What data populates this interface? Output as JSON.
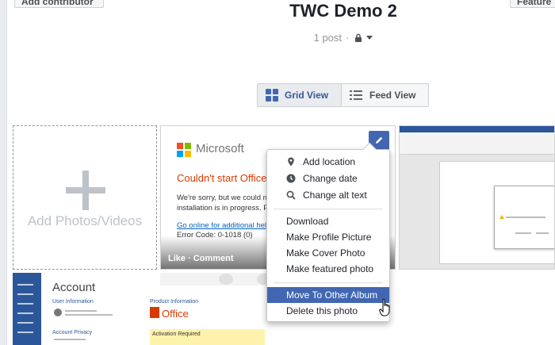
{
  "header": {
    "add_contributor_label": "Add contributor",
    "feature_label": "Feature",
    "album_title": "TWC Demo 2",
    "post_count": "1 post",
    "separator": "·"
  },
  "view_toggle": {
    "grid_label": "Grid View",
    "feed_label": "Feed View",
    "active": "grid"
  },
  "add_tile": {
    "label": "Add Photos/Videos"
  },
  "photo1": {
    "brand": "Microsoft",
    "error_title": "Couldn't start Office",
    "error_text_line1": "We're sorry, but we could not",
    "error_text_line2": "installation is in progress. Ple",
    "link_text": "Go online for additional help",
    "error_code": "Error Code: 0-1018 (0)",
    "overlay_text": "Like · Comment"
  },
  "photo3": {
    "title": "Account",
    "user_info": "User Information",
    "privacy": "Account Privacy"
  },
  "photo4": {
    "product_info": "Product Information",
    "office_word": "Office",
    "activation": "Activation Required"
  },
  "context_menu": {
    "group1": [
      {
        "label": "Add location",
        "icon": "location-pin-icon"
      },
      {
        "label": "Change date",
        "icon": "clock-icon"
      },
      {
        "label": "Change alt text",
        "icon": "magnifier-icon"
      }
    ],
    "group2": [
      "Download",
      "Make Profile Picture",
      "Make Cover Photo",
      "Make featured photo"
    ],
    "group3": [
      "Move To Other Album",
      "Delete this photo"
    ],
    "highlighted": "Move To Other Album"
  },
  "colors": {
    "accent": "#4267b2",
    "link": "#365899",
    "muted": "#90949c",
    "office_orange": "#d83b01"
  }
}
